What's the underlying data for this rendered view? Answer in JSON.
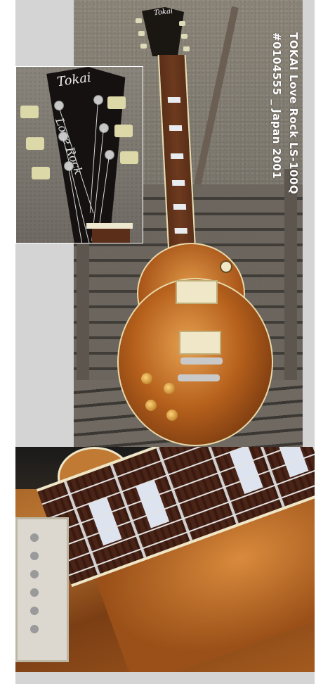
{
  "caption": {
    "line1": "TOKAI Love Rock LS-100Q",
    "line2": "#0104555 _ Japan 2001"
  },
  "headstock": {
    "brand": "Tokai",
    "model": "Love Rock"
  },
  "colors": {
    "frame": "#d4d4d4",
    "caption_text": "#ffffff",
    "body_finish": "#b5601c"
  },
  "photos": [
    "full-guitar-photo",
    "headstock-inset-photo",
    "fretboard-closeup-photo"
  ]
}
